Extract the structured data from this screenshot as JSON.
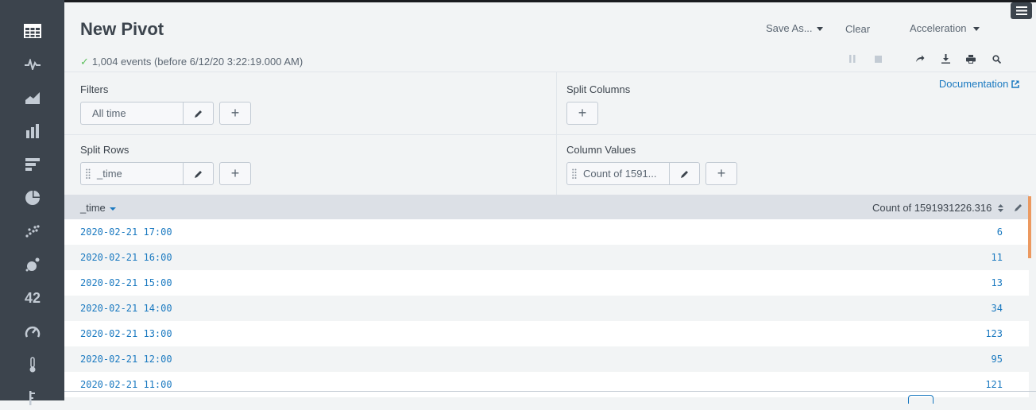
{
  "sidebar": {
    "items": [
      {
        "icon": "table-icon"
      },
      {
        "icon": "activity-icon"
      },
      {
        "icon": "area-chart-icon"
      },
      {
        "icon": "column-chart-icon"
      },
      {
        "icon": "bar-chart-icon"
      },
      {
        "icon": "pie-chart-icon"
      },
      {
        "icon": "scatter-chart-icon"
      },
      {
        "icon": "bubble-chart-icon"
      },
      {
        "icon": "single-value-icon",
        "label": "42"
      },
      {
        "icon": "radial-gauge-icon"
      },
      {
        "icon": "filler-gauge-icon"
      },
      {
        "icon": "marker-gauge-icon"
      }
    ]
  },
  "header": {
    "title": "New Pivot",
    "save_as": "Save As...",
    "clear": "Clear",
    "acceleration": "Acceleration",
    "status": "1,004 events (before 6/12/20 3:22:19.000 AM)"
  },
  "filters": {
    "label": "Filters",
    "pill": "All time"
  },
  "split_columns": {
    "label": "Split Columns"
  },
  "split_rows": {
    "label": "Split Rows",
    "pill": "_time"
  },
  "column_values": {
    "label": "Column Values",
    "pill": "Count of 1591..."
  },
  "documentation": "Documentation",
  "table": {
    "col1": "_time",
    "col2": "Count of 1591931226.316",
    "rows": [
      {
        "time": "2020-02-21 17:00",
        "count": "6"
      },
      {
        "time": "2020-02-21 16:00",
        "count": "11"
      },
      {
        "time": "2020-02-21 15:00",
        "count": "13"
      },
      {
        "time": "2020-02-21 14:00",
        "count": "34"
      },
      {
        "time": "2020-02-21 13:00",
        "count": "123"
      },
      {
        "time": "2020-02-21 12:00",
        "count": "95"
      },
      {
        "time": "2020-02-21 11:00",
        "count": "121"
      }
    ]
  },
  "colors": {
    "sidebar": "#3c444d",
    "link": "#1a79c0",
    "accent": "#ec9960"
  }
}
